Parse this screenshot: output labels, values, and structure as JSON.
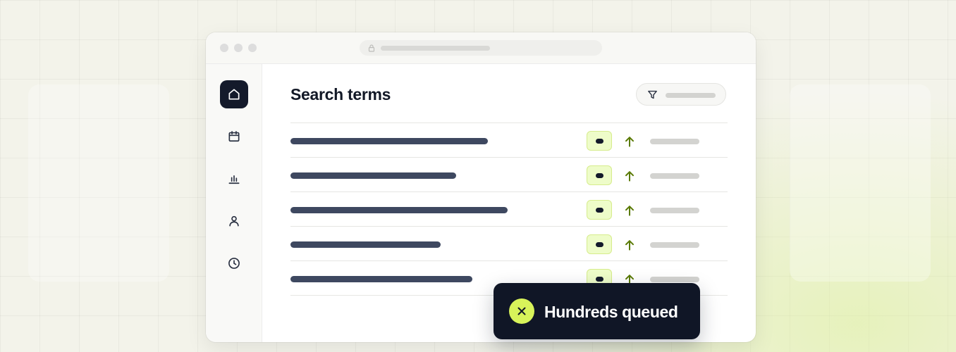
{
  "page": {
    "title": "Search terms"
  },
  "sidebar": {
    "items": [
      {
        "icon": "home-icon",
        "active": true
      },
      {
        "icon": "calendar-icon",
        "active": false
      },
      {
        "icon": "bar-chart-icon",
        "active": false
      },
      {
        "icon": "user-icon",
        "active": false
      },
      {
        "icon": "clock-icon",
        "active": false
      }
    ]
  },
  "toolbar": {
    "filter_icon": "filter-icon"
  },
  "table": {
    "rows": [
      {
        "trend": "up"
      },
      {
        "trend": "up"
      },
      {
        "trend": "up"
      },
      {
        "trend": "up"
      },
      {
        "trend": "up"
      }
    ]
  },
  "toast": {
    "icon": "close-icon",
    "message": "Hundreds queued"
  },
  "colors": {
    "accent": "#d8f35a",
    "badge_bg": "#eefcc9",
    "trend_up": "#5a7a05",
    "dark": "#141a2b",
    "active_nav": "#141a2b"
  }
}
